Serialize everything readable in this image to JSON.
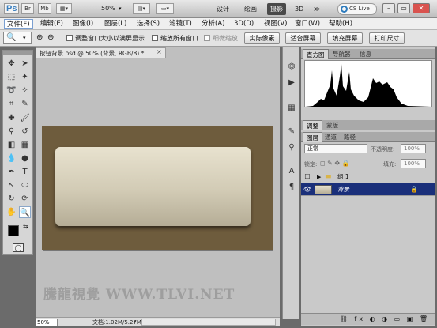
{
  "app": {
    "logo": "Ps",
    "br": "Br",
    "mb": "Mb",
    "zoom": "50%"
  },
  "workspaces": [
    "设计",
    "绘画",
    "摄影",
    "3D",
    "≫"
  ],
  "cslive": "CS Live",
  "window": {
    "minimize": "–",
    "restore": "▭",
    "close": "✕"
  },
  "menu": [
    "文件(F)",
    "编辑(E)",
    "图像(I)",
    "图层(L)",
    "选择(S)",
    "滤镜(T)",
    "分析(A)",
    "3D(D)",
    "视图(V)",
    "窗口(W)",
    "帮助(H)"
  ],
  "options": {
    "resize_windows": "调整窗口大小以满屏显示",
    "zoom_all": "缩放所有窗口",
    "scrubby_zoom": "细微缩放",
    "actual_pixels": "实际像素",
    "fit_screen": "适合屏幕",
    "fill_screen": "填充屏幕",
    "print_size": "打印尺寸"
  },
  "document": {
    "tab_title": "按钮背景.psd @ 50% (背景, RGB/8) *",
    "close": "×",
    "watermark": "騰龍視覺 WWW.TLVI.NET",
    "zoom_value": "50%",
    "doc_size": "文档:1.02M/5.27M"
  },
  "panels": {
    "top_tabs": [
      "直方图",
      "导航器",
      "信息"
    ],
    "mid_tabs": [
      "调整",
      "蒙版"
    ],
    "layer_tabs": [
      "图层",
      "通道",
      "路径"
    ],
    "blend_mode": "正常",
    "opacity_label": "不透明度:",
    "opacity_value": "100%",
    "lock_label": "锁定:",
    "fill_label": "填充:",
    "fill_value": "100%",
    "layers": [
      {
        "name": "组 1",
        "selected": false
      },
      {
        "name": "背景",
        "selected": true
      }
    ],
    "bottom_icons": "⛓ fx ◐ ◑ ▭ ▣ 🗑"
  }
}
